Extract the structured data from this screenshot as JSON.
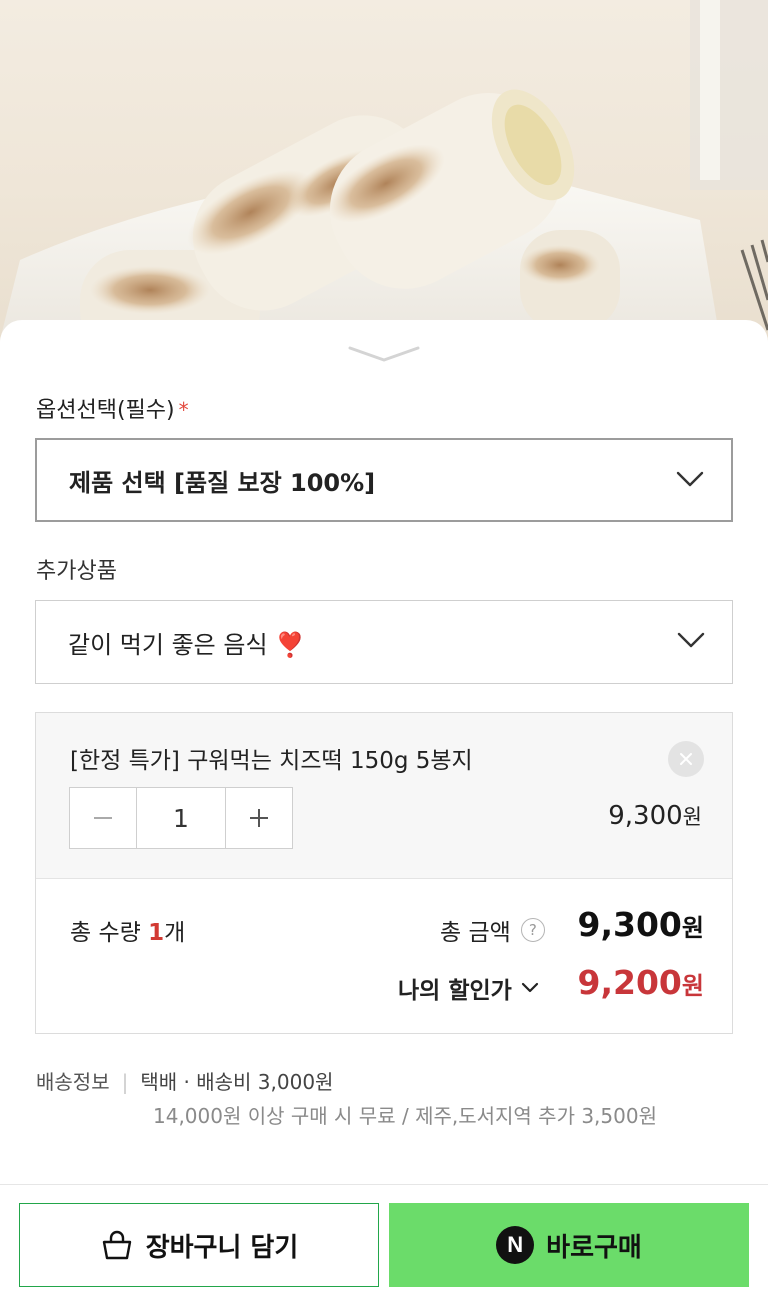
{
  "photo": {
    "icon": "product-photo-grilled-cheese-rice-cakes"
  },
  "options": {
    "required_label": "옵션선택(필수)",
    "required_mark": "*",
    "product_select_value": "제품 선택 [품질 보장 100%]",
    "addon_label": "추가상품",
    "addon_select_value": "같이 먹기 좋은 음식 ❣️"
  },
  "selected_item": {
    "name": "[한정 특가] 구워먹는 치즈떡 150g 5봉지",
    "quantity": "1",
    "price": "9,300",
    "price_unit": "원",
    "remove_icon": "close-icon"
  },
  "summary": {
    "total_qty_label": "총 수량",
    "total_qty_value": "1",
    "total_qty_unit": "개",
    "total_amount_label": "총 금액",
    "help_glyph": "?",
    "total_amount": "9,300",
    "total_amount_unit": "원",
    "discount_label": "나의 할인가",
    "discount_amount": "9,200",
    "discount_unit": "원"
  },
  "shipping": {
    "label": "배송정보",
    "method": "택배 · 배송비 3,000원",
    "note": "14,000원 이상 구매 시 무료 / 제주,도서지역 추가 3,500원"
  },
  "actions": {
    "cart_label": "장바구니 담기",
    "buy_label": "바로구매",
    "npay_glyph": "N"
  },
  "colors": {
    "accent_green": "#6bdc6a",
    "discount_red": "#c8363a",
    "required_red": "#e2483d"
  }
}
